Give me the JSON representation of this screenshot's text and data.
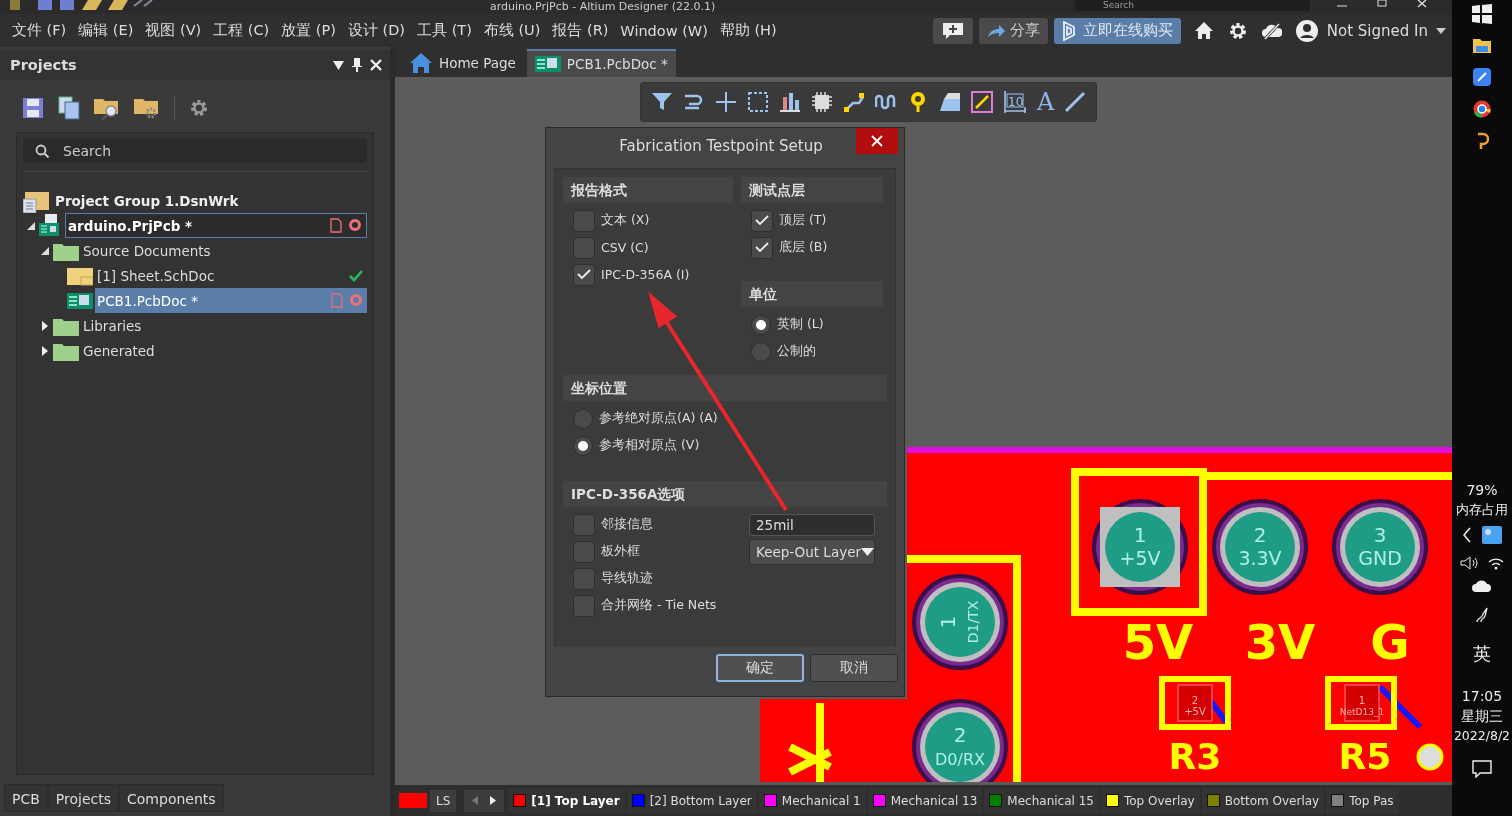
{
  "window": {
    "title": "arduino.PrjPcb - Altium Designer (22.0.1)",
    "search_placeholder": "Search"
  },
  "menu": [
    "文件 (F)",
    "编辑 (E)",
    "视图 (V)",
    "工程 (C)",
    "放置 (P)",
    "设计 (D)",
    "工具 (T)",
    "布线 (U)",
    "报告 (R)",
    "Window (W)",
    "帮助 (H)"
  ],
  "header_actions": {
    "share": "分享",
    "buy": "立即在线购买",
    "user": "Not Signed In"
  },
  "projects_panel": {
    "title": "Projects",
    "search": {
      "placeholder": "Search"
    },
    "tree": [
      {
        "label": "Project Group 1.DsnWrk",
        "kind": "group",
        "selected": false,
        "focused": false,
        "modified": false,
        "saved": false,
        "children": [
          {
            "label": "arduino.PrjPcb *",
            "kind": "project",
            "selected": false,
            "focused": true,
            "expanded": true,
            "modified": true,
            "saved": false,
            "children": [
              {
                "label": "Source Documents",
                "kind": "folder",
                "selected": false,
                "focused": false,
                "expanded": true,
                "modified": false,
                "saved": false,
                "children": [
                  {
                    "label": "[1] Sheet.SchDoc",
                    "kind": "sch",
                    "selected": false,
                    "focused": false,
                    "modified": false,
                    "saved": true
                  },
                  {
                    "label": "PCB1.PcbDoc *",
                    "kind": "pcb",
                    "selected": true,
                    "focused": false,
                    "modified": true,
                    "saved": false
                  }
                ]
              },
              {
                "label": "Libraries",
                "kind": "folder",
                "selected": false,
                "focused": false,
                "expanded": false,
                "modified": false,
                "saved": false
              },
              {
                "label": "Generated",
                "kind": "folder",
                "selected": false,
                "focused": false,
                "expanded": false,
                "modified": false,
                "saved": false
              }
            ]
          }
        ]
      }
    ],
    "tabs": [
      "PCB",
      "Projects",
      "Components"
    ]
  },
  "doc_tabs": [
    {
      "label": "Home Page",
      "kind": "home",
      "selected": false
    },
    {
      "label": "PCB1.PcbDoc *",
      "kind": "pcb",
      "selected": true
    }
  ],
  "canvas_toolbar": {
    "dimension_label": "10",
    "text_tool": "A"
  },
  "dialog": {
    "title": "Fabrication Testpoint Setup",
    "report_format": {
      "heading": "报告格式",
      "options": [
        {
          "label": "文本 (X)",
          "checked": false
        },
        {
          "label": "CSV (C)",
          "checked": false
        },
        {
          "label": "IPC-D-356A (I)",
          "checked": true
        }
      ]
    },
    "testpoint_layers": {
      "heading": "测试点层",
      "options": [
        {
          "label": "顶层 (T)",
          "checked": true
        },
        {
          "label": "底层 (B)",
          "checked": true
        }
      ]
    },
    "units": {
      "heading": "单位",
      "options": [
        {
          "label": "英制 (L)",
          "selected": true
        },
        {
          "label": "公制的",
          "selected": false
        }
      ]
    },
    "coordinates": {
      "heading": "坐标位置",
      "options": [
        {
          "label": "参考绝对原点(A) (A)",
          "selected": false
        },
        {
          "label": "参考相对原点 (V)",
          "selected": true
        }
      ]
    },
    "ipc_options": {
      "heading": "IPC-D-356A选项",
      "options": [
        {
          "label": "邻接信息",
          "checked": false
        },
        {
          "label": "板外框",
          "checked": false
        },
        {
          "label": "导线轨迹",
          "checked": false
        },
        {
          "label": "合并网络 - Tie Nets",
          "checked": false
        }
      ],
      "adjacency_value": "25mil",
      "outline_layer": "Keep-Out Layer"
    },
    "buttons": [
      "确定",
      "取消"
    ]
  },
  "pcb": {
    "pads": [
      {
        "number": "1",
        "net": "+5V"
      },
      {
        "number": "2",
        "net": "3.3V"
      },
      {
        "number": "3",
        "net": "GND"
      },
      {
        "number": "1",
        "net": "D1/TX"
      },
      {
        "number": "2",
        "net": "D0/RX"
      }
    ],
    "silkscreen": [
      "5V",
      "3V",
      "G",
      "R3",
      "R5"
    ],
    "small_pads": [
      {
        "number": "2",
        "net": "+5V"
      },
      {
        "number": "1",
        "net": "NetD13_1"
      }
    ]
  },
  "layer_bar": {
    "current": {
      "label": "LS",
      "color": "#ff0000"
    },
    "layers": [
      {
        "label": "[1] Top Layer",
        "color": "#ff0000",
        "selected": true
      },
      {
        "label": "[2] Bottom Layer",
        "color": "#0000ff",
        "selected": false
      },
      {
        "label": "Mechanical 1",
        "color": "#ff00ff",
        "selected": false
      },
      {
        "label": "Mechanical 13",
        "color": "#ff00ff",
        "selected": false
      },
      {
        "label": "Mechanical 15",
        "color": "#008000",
        "selected": false
      },
      {
        "label": "Top Overlay",
        "color": "#ffff00",
        "selected": false
      },
      {
        "label": "Bottom Overlay",
        "color": "#808000",
        "selected": false
      },
      {
        "label": "Top Pas",
        "color": "#808080",
        "selected": false
      }
    ]
  },
  "tray": {
    "memory": "79%",
    "memory_label": "内存占用",
    "ime": "英",
    "time": "17:05",
    "weekday": "星期三",
    "date": "2022/8/2"
  }
}
